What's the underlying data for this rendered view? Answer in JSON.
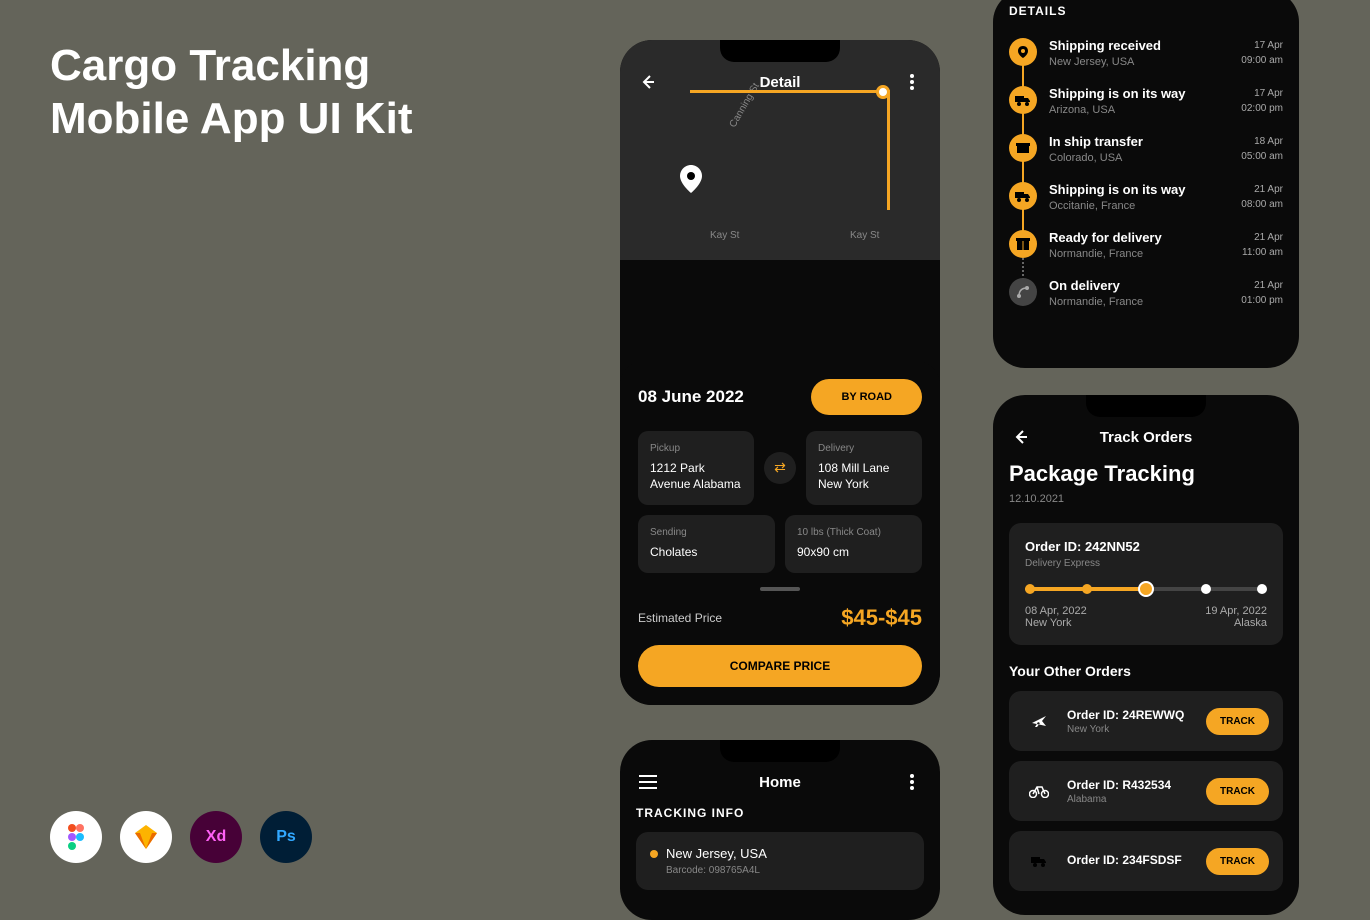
{
  "title_line1": "Cargo Tracking",
  "title_line2": "Mobile App UI Kit",
  "tools": [
    "figma",
    "sketch",
    "xd",
    "photoshop"
  ],
  "phone1": {
    "header": "Detail",
    "date": "08 June 2022",
    "road_btn": "BY ROAD",
    "pickup_label": "Pickup",
    "pickup_value": "1212 Park Avenue Alabama",
    "delivery_label": "Delivery",
    "delivery_value": "108 Mill Lane New York",
    "sending_label": "Sending",
    "sending_value": "Cholates",
    "dims_label": "10 lbs (Thick Coat)",
    "dims_value": "90x90 cm",
    "price_label": "Estimated Price",
    "price_value": "$45-$45",
    "compare_btn": "COMPARE PRICE"
  },
  "phone2": {
    "heading": "DETAILS",
    "items": [
      {
        "title": "Shipping received",
        "sub": "New Jersey, USA",
        "date": "17 Apr",
        "time": "09:00 am",
        "icon": "pin"
      },
      {
        "title": "Shipping is on its way",
        "sub": "Arizona, USA",
        "date": "17 Apr",
        "time": "02:00 pm",
        "icon": "truck"
      },
      {
        "title": "In ship transfer",
        "sub": "Colorado, USA",
        "date": "18 Apr",
        "time": "05:00 am",
        "icon": "box"
      },
      {
        "title": "Shipping is on its way",
        "sub": "Occitanie, France",
        "date": "21 Apr",
        "time": "08:00 am",
        "icon": "truck"
      },
      {
        "title": "Ready for delivery",
        "sub": "Normandie, France",
        "date": "21 Apr",
        "time": "11:00 am",
        "icon": "package"
      },
      {
        "title": "On delivery",
        "sub": "Normandie, France",
        "date": "21 Apr",
        "time": "01:00 pm",
        "icon": "route",
        "inactive": true
      }
    ]
  },
  "phone3": {
    "header": "Track Orders",
    "title": "Package Tracking",
    "date": "12.10.2021",
    "order_id": "Order ID: 242NN52",
    "order_sub": "Delivery Express",
    "from_date": "08 Apr, 2022",
    "from_loc": "New York",
    "to_date": "19 Apr, 2022",
    "to_loc": "Alaska",
    "other_heading": "Your Other Orders",
    "others": [
      {
        "id": "Order ID: 24REWWQ",
        "loc": "New York",
        "icon": "plane"
      },
      {
        "id": "Order ID: R432534",
        "loc": "Alabama",
        "icon": "bike"
      },
      {
        "id": "Order ID: 234FSDSF",
        "loc": "",
        "icon": "truck"
      }
    ],
    "track_btn": "TRACK"
  },
  "phone4": {
    "header": "Home",
    "heading": "TRACKING INFO",
    "loc": "New Jersey, USA",
    "barcode": "Barcode: 098765A4L"
  }
}
